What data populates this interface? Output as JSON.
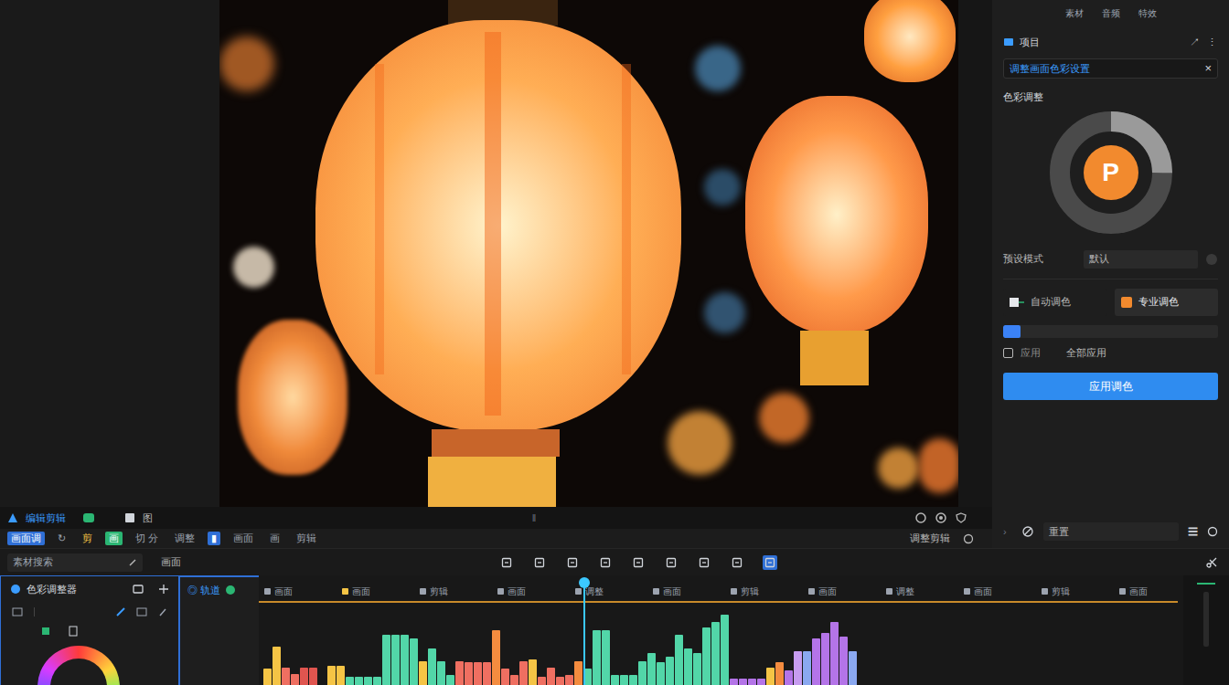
{
  "preview_bar": {
    "title": "编辑剪辑",
    "label": "图",
    "transport": "‖"
  },
  "clip_bar": {
    "items": [
      {
        "label": "画面调",
        "selected": true,
        "color": "#2f6fd6"
      },
      {
        "label": "↻",
        "selected": false,
        "color": "#9ca3af"
      },
      {
        "label": "剪",
        "selected": false,
        "color": "#f5c445"
      },
      {
        "label": "画",
        "selected": true,
        "color": "#2bb673"
      },
      {
        "label": "切 分",
        "selected": false,
        "color": "#9ca3af"
      },
      {
        "label": "调整",
        "selected": false,
        "color": "#9ca3af"
      },
      {
        "label": "▮",
        "selected": true,
        "color": "#2f6fd6"
      },
      {
        "label": "画面",
        "selected": false,
        "color": "#9ca3af"
      },
      {
        "label": "画",
        "selected": false,
        "color": "#9ca3af"
      },
      {
        "label": "剪辑",
        "selected": false,
        "color": "#9ca3af"
      }
    ],
    "right_label": "调整剪辑"
  },
  "right_panel": {
    "tabs": [
      {
        "label": "素材",
        "selected": false
      },
      {
        "label": "音频",
        "selected": false
      },
      {
        "label": "特效",
        "selected": false
      }
    ],
    "header": {
      "label": "项目",
      "icon": "↗",
      "menu": "⋮"
    },
    "search": {
      "value": "调整画面色彩设置",
      "clear": "×"
    },
    "section_title": "色彩调整",
    "donut": {
      "letter": "P",
      "level": 0.25
    },
    "preset": {
      "label": "预设模式",
      "value": "默认"
    },
    "cards": [
      {
        "label": "自动调色",
        "selected": false
      },
      {
        "label": "专业调色",
        "selected": true
      }
    ],
    "progress": {
      "level": 0.08
    },
    "option": {
      "label": "应用",
      "checked": false,
      "label2": "全部应用"
    },
    "button": "应用调色",
    "footer": {
      "label": "重置",
      "menu": "☰"
    }
  },
  "search_row": {
    "placeholder": "素材搜索",
    "label": "画面",
    "tools": [
      {
        "selected": false
      },
      {
        "selected": false
      },
      {
        "selected": false
      },
      {
        "selected": false
      },
      {
        "selected": false
      },
      {
        "selected": false
      },
      {
        "selected": false
      },
      {
        "selected": false
      },
      {
        "selected": true
      }
    ]
  },
  "color_panel": {
    "title": "色彩调整器"
  },
  "track_header": {
    "label": "◎ 轨道"
  },
  "timeline": {
    "ruler": [
      {
        "label": "画面",
        "color": "#9ca3af"
      },
      {
        "label": "画面",
        "color": "#f5c445"
      },
      {
        "label": "剪辑",
        "color": "#9ca3af"
      },
      {
        "label": "画面",
        "color": "#9ca3af"
      },
      {
        "label": "调整",
        "color": "#9ca3af"
      },
      {
        "label": "画面",
        "color": "#9ca3af"
      },
      {
        "label": "剪辑",
        "color": "#9ca3af"
      },
      {
        "label": "画面",
        "color": "#9ca3af"
      },
      {
        "label": "调整",
        "color": "#9ca3af"
      },
      {
        "label": "画面",
        "color": "#9ca3af"
      },
      {
        "label": "剪辑",
        "color": "#9ca3af"
      },
      {
        "label": "画面",
        "color": "#9ca3af"
      }
    ],
    "bars": [
      {
        "value": 20,
        "color": "#f5c445"
      },
      {
        "value": 48,
        "color": "#f5c445"
      },
      {
        "value": 22,
        "color": "#ef6f61"
      },
      {
        "value": 14,
        "color": "#ef6f61"
      },
      {
        "value": 22,
        "color": "#e0554f"
      },
      {
        "value": 22,
        "color": "#e0554f"
      },
      {
        "value": 0,
        "color": "#e0554f"
      },
      {
        "value": 24,
        "color": "#f5c445"
      },
      {
        "value": 24,
        "color": "#f5c445"
      },
      {
        "value": 10,
        "color": "#52d6a8"
      },
      {
        "value": 10,
        "color": "#52d6a8"
      },
      {
        "value": 10,
        "color": "#52d6a8"
      },
      {
        "value": 10,
        "color": "#52d6a8"
      },
      {
        "value": 62,
        "color": "#52d6a8"
      },
      {
        "value": 62,
        "color": "#52d6a8"
      },
      {
        "value": 62,
        "color": "#52d6a8"
      },
      {
        "value": 58,
        "color": "#52d6a8"
      },
      {
        "value": 30,
        "color": "#f5c445"
      },
      {
        "value": 45,
        "color": "#52d6a8"
      },
      {
        "value": 30,
        "color": "#52d6a8"
      },
      {
        "value": 12,
        "color": "#52d6a8"
      },
      {
        "value": 30,
        "color": "#ef6f61"
      },
      {
        "value": 28,
        "color": "#ef6f61"
      },
      {
        "value": 28,
        "color": "#ef6f61"
      },
      {
        "value": 28,
        "color": "#ef6f61"
      },
      {
        "value": 68,
        "color": "#f48c3f"
      },
      {
        "value": 20,
        "color": "#ef6f61"
      },
      {
        "value": 12,
        "color": "#ef6f61"
      },
      {
        "value": 30,
        "color": "#ef6f61"
      },
      {
        "value": 32,
        "color": "#f5c445"
      },
      {
        "value": 10,
        "color": "#ef6f61"
      },
      {
        "value": 22,
        "color": "#ef6f61"
      },
      {
        "value": 10,
        "color": "#ef6f61"
      },
      {
        "value": 12,
        "color": "#ef6f61"
      },
      {
        "value": 30,
        "color": "#f48c3f"
      },
      {
        "value": 20,
        "color": "#52d6a8"
      },
      {
        "value": 68,
        "color": "#52d6a8"
      },
      {
        "value": 68,
        "color": "#52d6a8"
      },
      {
        "value": 12,
        "color": "#52d6a8"
      },
      {
        "value": 12,
        "color": "#52d6a8"
      },
      {
        "value": 12,
        "color": "#52d6a8"
      },
      {
        "value": 30,
        "color": "#52d6a8"
      },
      {
        "value": 40,
        "color": "#52d6a8"
      },
      {
        "value": 28,
        "color": "#52d6a8"
      },
      {
        "value": 35,
        "color": "#52d6a8"
      },
      {
        "value": 62,
        "color": "#52d6a8"
      },
      {
        "value": 45,
        "color": "#52d6a8"
      },
      {
        "value": 40,
        "color": "#52d6a8"
      },
      {
        "value": 72,
        "color": "#52d6a8"
      },
      {
        "value": 78,
        "color": "#52d6a8"
      },
      {
        "value": 88,
        "color": "#52d6a8"
      },
      {
        "value": 8,
        "color": "#b474e8"
      },
      {
        "value": 8,
        "color": "#b474e8"
      },
      {
        "value": 8,
        "color": "#b474e8"
      },
      {
        "value": 8,
        "color": "#b474e8"
      },
      {
        "value": 22,
        "color": "#f5c445"
      },
      {
        "value": 28,
        "color": "#f48c3f"
      },
      {
        "value": 18,
        "color": "#b474e8"
      },
      {
        "value": 42,
        "color": "#c79cf0"
      },
      {
        "value": 42,
        "color": "#8aa8f0"
      },
      {
        "value": 58,
        "color": "#b474e8"
      },
      {
        "value": 65,
        "color": "#b474e8"
      },
      {
        "value": 78,
        "color": "#b474e8"
      },
      {
        "value": 60,
        "color": "#b474e8"
      },
      {
        "value": 42,
        "color": "#8aa8f0"
      }
    ]
  }
}
